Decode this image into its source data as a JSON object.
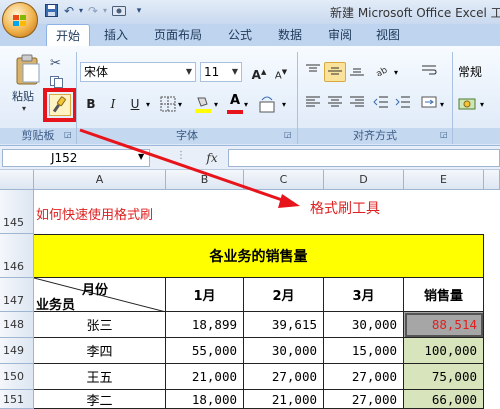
{
  "title": {
    "text": "新建 Microsoft Office Excel 工"
  },
  "tabs": [
    "开始",
    "插入",
    "页面布局",
    "公式",
    "数据",
    "审阅",
    "视图"
  ],
  "clipboard": {
    "paste_label": "粘贴",
    "group_label": "剪贴板"
  },
  "font": {
    "name": "宋体",
    "size": "11",
    "bold": "B",
    "italic": "I",
    "underline": "U",
    "group_label": "字体",
    "grow": "A",
    "shrink": "A",
    "color_a": "A"
  },
  "align": {
    "group_label": "对齐方式"
  },
  "number": {
    "format": "常规"
  },
  "formula_bar": {
    "name_box": "J152",
    "fx": "fx"
  },
  "columns": [
    "A",
    "B",
    "C",
    "D",
    "E"
  ],
  "rows": [
    "145",
    "146",
    "147",
    "148",
    "149",
    "150",
    "151"
  ],
  "annotations": {
    "a145": "如何快速使用格式刷",
    "arrow_label": "格式刷工具"
  },
  "sheet": {
    "header": "各业务的销售量",
    "corner_month": "月份",
    "corner_person": "业务员",
    "months": [
      "1月",
      "2月",
      "3月",
      "销售量"
    ],
    "data": [
      {
        "name": "张三",
        "values": [
          "18,899",
          "39,615",
          "30,000",
          "88,514"
        ]
      },
      {
        "name": "李四",
        "values": [
          "55,000",
          "30,000",
          "15,000",
          "100,000"
        ]
      },
      {
        "name": "王五",
        "values": [
          "21,000",
          "27,000",
          "27,000",
          "75,000"
        ]
      },
      {
        "name": "李二",
        "values": [
          "18,000",
          "21,000",
          "27,000",
          "66,000"
        ]
      }
    ]
  },
  "colors": {
    "header_fill": "#ffff00",
    "total_fill": "#d8e4bc",
    "selected_fill": "#a6a6a6",
    "annotation_red": "#e02020",
    "highlight_box": "#e8141b"
  }
}
